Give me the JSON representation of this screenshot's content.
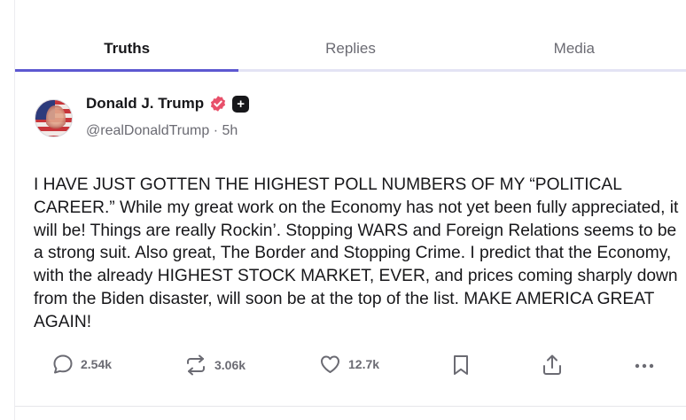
{
  "tabs": [
    {
      "label": "Truths",
      "active": true
    },
    {
      "label": "Replies",
      "active": false
    },
    {
      "label": "Media",
      "active": false
    }
  ],
  "post": {
    "author": {
      "display_name": "Donald J. Trump",
      "handle": "@realDonaldTrump",
      "time": "5h",
      "separator": "·"
    },
    "body": "I HAVE JUST GOTTEN THE HIGHEST POLL NUMBERS OF MY “POLITICAL CAREER.” While my great work on the Economy has not yet been fully appreciated, it will be! Things are really Rockin’. Stopping WARS and Foreign Relations seems to be a strong suit. Also great, The Border and Stopping Crime. I predict that the Economy, with the already HIGHEST STOCK MARKET, EVER, and prices coming sharply down from the Biden disaster, will soon be at the top of the list. MAKE AMERICA GREAT AGAIN!",
    "stats": {
      "replies": "2.54k",
      "retruths": "3.06k",
      "likes": "12.7k"
    }
  },
  "icons": {
    "verified": "verified-badge-icon",
    "plus": "plus-badge-icon",
    "reply": "reply-icon",
    "retruth": "retruth-icon",
    "like": "heart-icon",
    "bookmark": "bookmark-icon",
    "share": "share-icon",
    "more": "more-icon"
  },
  "colors": {
    "accent": "#5d58d1",
    "verified": "#e8506a",
    "muted_text": "#6b6b73"
  }
}
